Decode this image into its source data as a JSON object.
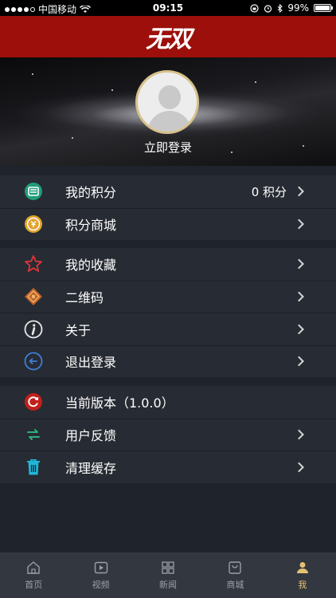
{
  "status_bar": {
    "carrier": "中国移动",
    "time": "09:15",
    "battery": "99%",
    "battery_level": 0.99
  },
  "header": {
    "logo_text": "无双"
  },
  "profile": {
    "login_label": "立即登录"
  },
  "menu_groups": [
    {
      "items": [
        {
          "label": "我的积分",
          "value": "0 积分",
          "icon": "points-icon",
          "chevron": true
        },
        {
          "label": "积分商城",
          "icon": "points-mall-icon",
          "chevron": true
        }
      ]
    },
    {
      "items": [
        {
          "label": "我的收藏",
          "icon": "star-icon",
          "chevron": true
        },
        {
          "label": "二维码",
          "icon": "qrcode-icon",
          "chevron": true
        },
        {
          "label": "关于",
          "icon": "info-icon",
          "chevron": true
        },
        {
          "label": "退出登录",
          "icon": "logout-icon",
          "chevron": true
        }
      ]
    },
    {
      "items": [
        {
          "label": "当前版本（1.0.0）",
          "icon": "version-icon",
          "chevron": false
        },
        {
          "label": "用户反馈",
          "icon": "feedback-icon",
          "chevron": true
        },
        {
          "label": "清理缓存",
          "icon": "trash-icon",
          "chevron": true
        }
      ]
    }
  ],
  "tabs": [
    {
      "label": "首页",
      "icon": "home-icon"
    },
    {
      "label": "视频",
      "icon": "video-icon"
    },
    {
      "label": "新闻",
      "icon": "news-icon"
    },
    {
      "label": "商城",
      "icon": "mall-icon"
    },
    {
      "label": "我",
      "icon": "profile-icon",
      "active": true
    }
  ],
  "colors": {
    "header_red": "#9c0f0b",
    "accent_gold": "#e3c16f",
    "background": "#1f232b",
    "menu_bg": "#272b33",
    "tab_bar_bg": "#323740"
  }
}
